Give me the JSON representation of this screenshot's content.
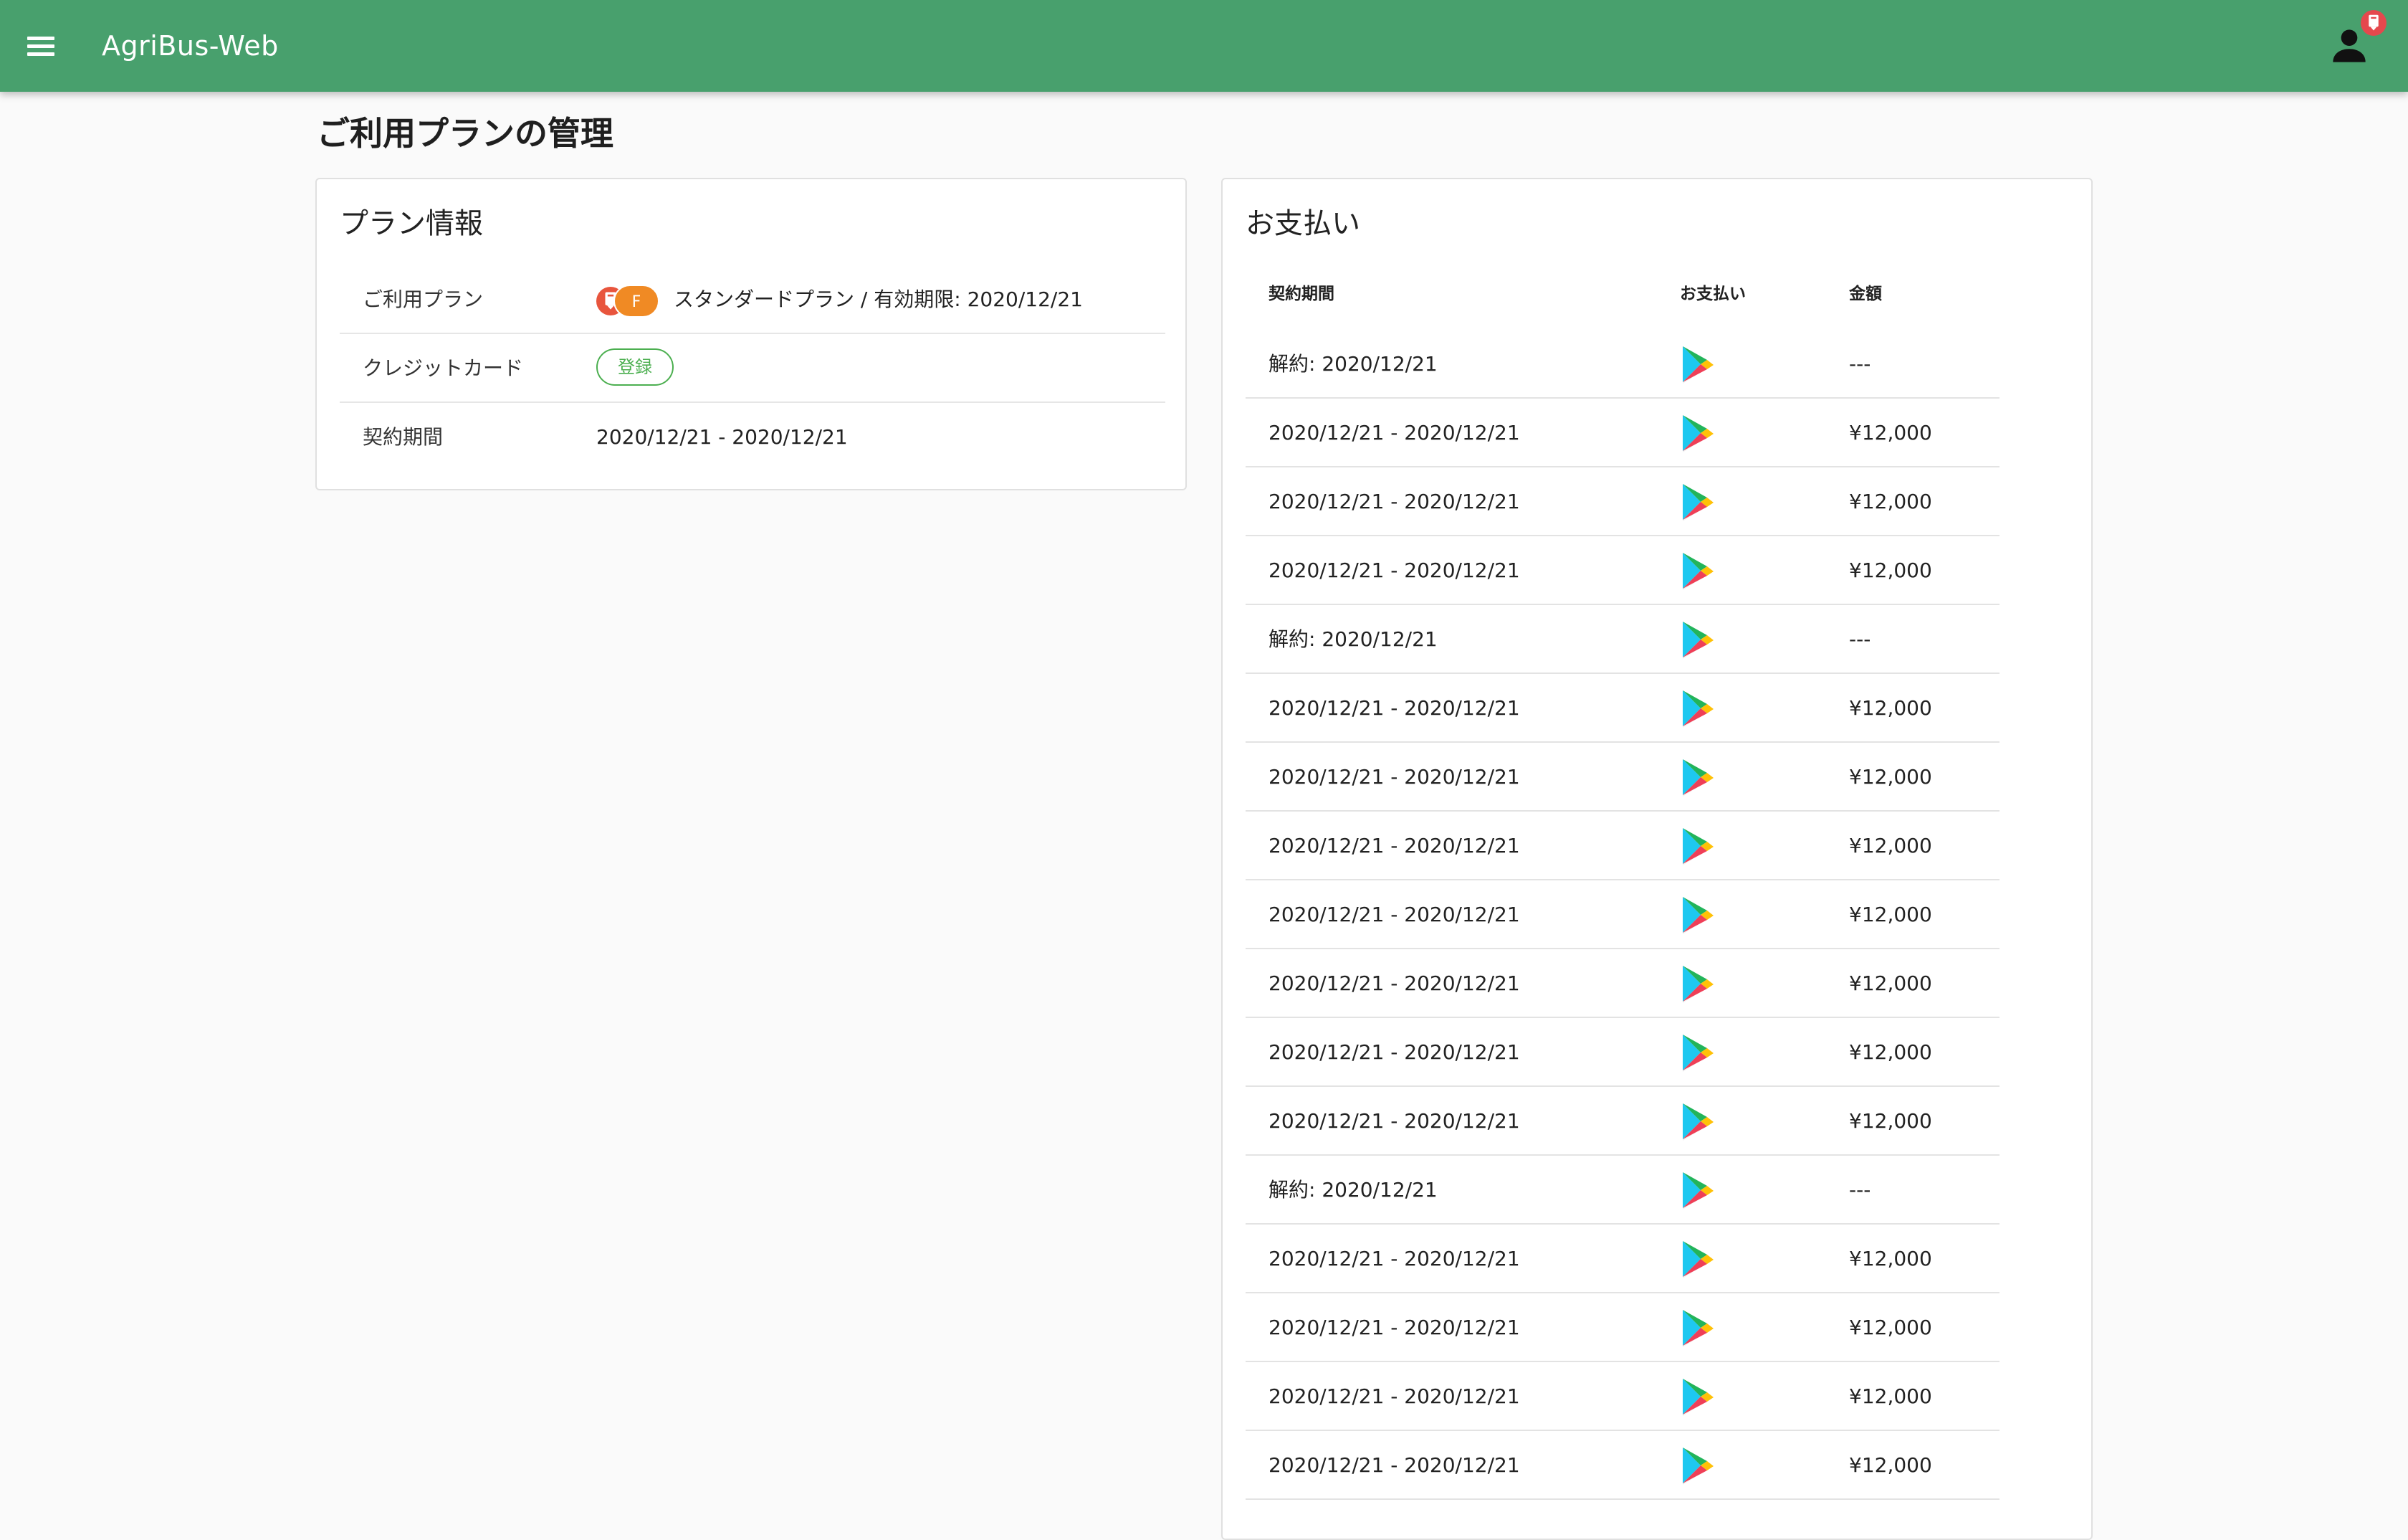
{
  "app": {
    "title": "AgriBus-Web"
  },
  "page": {
    "title": "ご利用プランの管理"
  },
  "plan_card": {
    "title": "プラン情報",
    "rows": {
      "plan": {
        "label": "ご利用プラン",
        "badge": "F",
        "value": "スタンダードプラン / 有効期限: 2020/12/21"
      },
      "credit_card": {
        "label": "クレジットカード",
        "button": "登録"
      },
      "period": {
        "label": "契約期間",
        "value": "2020/12/21 - 2020/12/21"
      }
    }
  },
  "payment_card": {
    "title": "お支払い",
    "columns": {
      "period": "契約期間",
      "method": "お支払い",
      "amount": "金額"
    },
    "rows": [
      {
        "period": "解約: 2020/12/21",
        "method": "google-play-icon",
        "amount": "---"
      },
      {
        "period": "2020/12/21 - 2020/12/21",
        "method": "google-play-icon",
        "amount": "¥12,000"
      },
      {
        "period": "2020/12/21 - 2020/12/21",
        "method": "google-play-icon",
        "amount": "¥12,000"
      },
      {
        "period": "2020/12/21 - 2020/12/21",
        "method": "google-play-icon",
        "amount": "¥12,000"
      },
      {
        "period": "解約: 2020/12/21",
        "method": "google-play-icon",
        "amount": "---"
      },
      {
        "period": "2020/12/21 - 2020/12/21",
        "method": "google-play-icon",
        "amount": "¥12,000"
      },
      {
        "period": "2020/12/21 - 2020/12/21",
        "method": "google-play-icon",
        "amount": "¥12,000"
      },
      {
        "period": "2020/12/21 - 2020/12/21",
        "method": "google-play-icon",
        "amount": "¥12,000"
      },
      {
        "period": "2020/12/21 - 2020/12/21",
        "method": "google-play-icon",
        "amount": "¥12,000"
      },
      {
        "period": "2020/12/21 - 2020/12/21",
        "method": "google-play-icon",
        "amount": "¥12,000"
      },
      {
        "period": "2020/12/21 - 2020/12/21",
        "method": "google-play-icon",
        "amount": "¥12,000"
      },
      {
        "period": "2020/12/21 - 2020/12/21",
        "method": "google-play-icon",
        "amount": "¥12,000"
      },
      {
        "period": "解約: 2020/12/21",
        "method": "google-play-icon",
        "amount": "---"
      },
      {
        "period": "2020/12/21 - 2020/12/21",
        "method": "google-play-icon",
        "amount": "¥12,000"
      },
      {
        "period": "2020/12/21 - 2020/12/21",
        "method": "google-play-icon",
        "amount": "¥12,000"
      },
      {
        "period": "2020/12/21 - 2020/12/21",
        "method": "google-play-icon",
        "amount": "¥12,000"
      },
      {
        "period": "2020/12/21 - 2020/12/21",
        "method": "google-play-icon",
        "amount": "¥12,000"
      }
    ]
  },
  "colors": {
    "app_bar": "#48a06d",
    "badge_red": "#e8553d",
    "badge_orange": "#f08a24",
    "register_button": "#4caf50",
    "background": "#fafafa"
  },
  "icons": {
    "menu": "menu-icon",
    "account": "account-icon",
    "notification": "notification-badge-icon",
    "payment_method": "google-play-icon"
  }
}
